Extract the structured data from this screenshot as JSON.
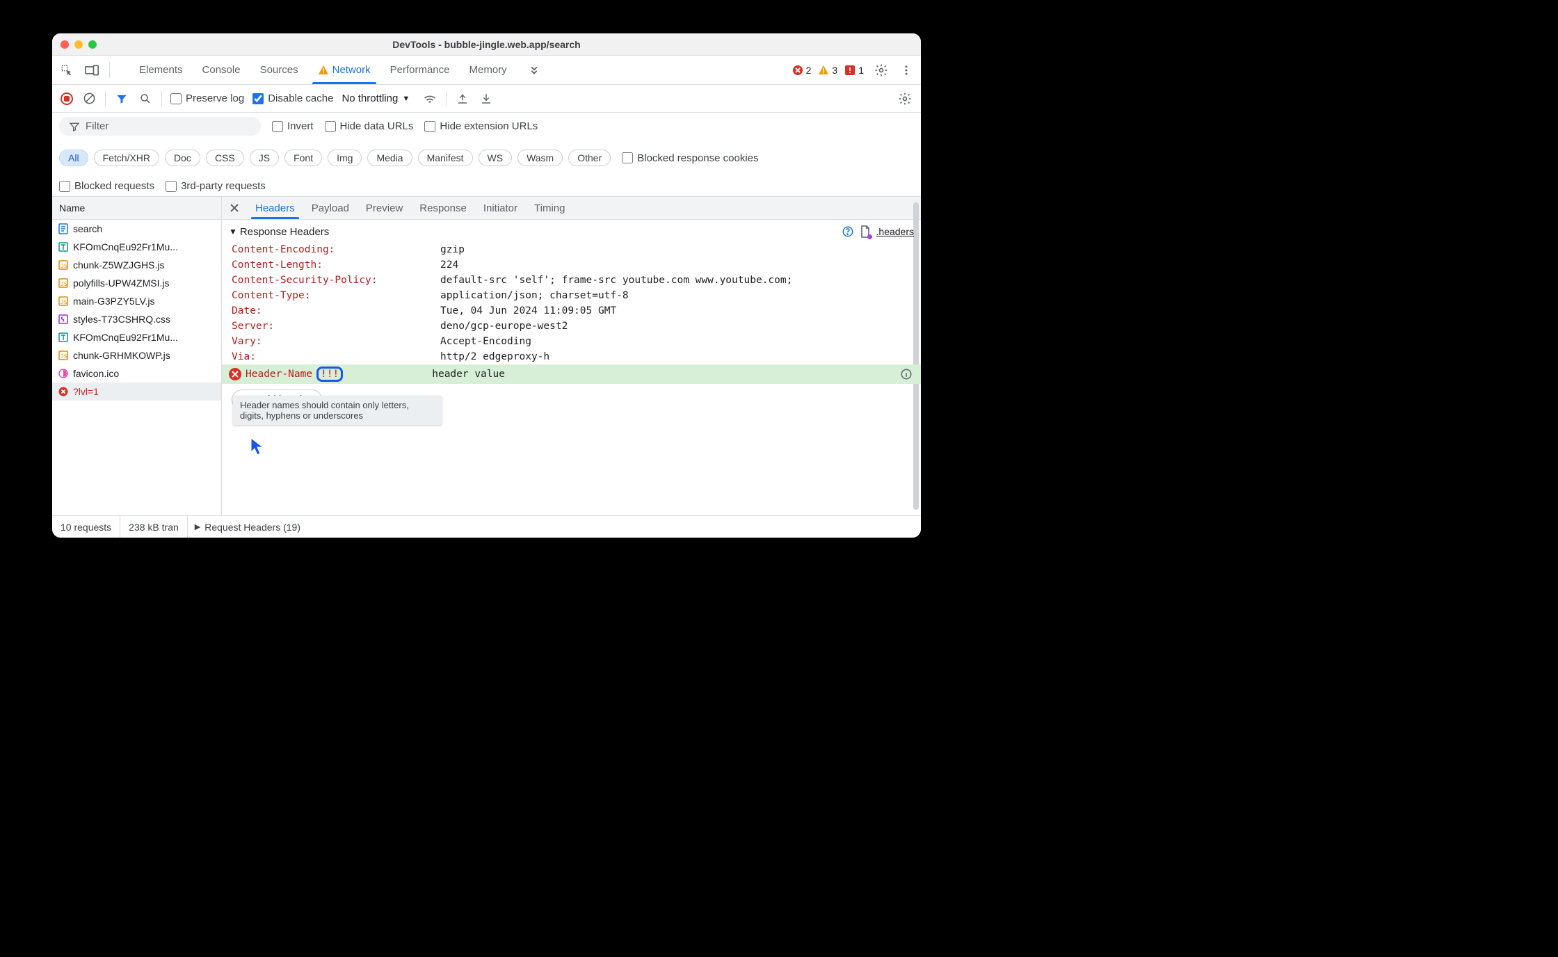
{
  "window": {
    "title": "DevTools - bubble-jingle.web.app/search"
  },
  "devtools_tabs": {
    "items": [
      "Elements",
      "Console",
      "Sources",
      "Network",
      "Performance",
      "Memory"
    ],
    "active": "Network"
  },
  "indicators": {
    "errors": "2",
    "warnings": "3",
    "issues": "1"
  },
  "net_toolbar": {
    "preserve_log": "Preserve log",
    "disable_cache": "Disable cache",
    "throttling": "No throttling"
  },
  "filterbar": {
    "filter_placeholder": "Filter",
    "invert": "Invert",
    "hide_data_urls": "Hide data URLs",
    "hide_ext_urls": "Hide extension URLs",
    "type_chips": [
      "All",
      "Fetch/XHR",
      "Doc",
      "CSS",
      "JS",
      "Font",
      "Img",
      "Media",
      "Manifest",
      "WS",
      "Wasm",
      "Other"
    ],
    "blocked_cookies": "Blocked response cookies",
    "blocked_requests": "Blocked requests",
    "third_party": "3rd-party requests"
  },
  "name_col_header": "Name",
  "requests": [
    {
      "icon": "doc-blue",
      "name": "search"
    },
    {
      "icon": "font",
      "name": "KFOmCnqEu92Fr1Mu..."
    },
    {
      "icon": "js",
      "name": "chunk-Z5WZJGHS.js"
    },
    {
      "icon": "js",
      "name": "polyfills-UPW4ZMSI.js"
    },
    {
      "icon": "js",
      "name": "main-G3PZY5LV.js"
    },
    {
      "icon": "css",
      "name": "styles-T73CSHRQ.css"
    },
    {
      "icon": "font",
      "name": "KFOmCnqEu92Fr1Mu..."
    },
    {
      "icon": "js",
      "name": "chunk-GRHMKOWP.js"
    },
    {
      "icon": "fav",
      "name": "favicon.ico"
    },
    {
      "icon": "err",
      "name": "?lvl=1",
      "selected": true,
      "error": true
    }
  ],
  "detail_tabs": {
    "items": [
      "Headers",
      "Payload",
      "Preview",
      "Response",
      "Initiator",
      "Timing"
    ],
    "active": "Headers"
  },
  "response_headers": {
    "title": "Response Headers",
    "overrides_link": ".headers",
    "rows": [
      {
        "name": "Content-Encoding:",
        "value": "gzip"
      },
      {
        "name": "Content-Length:",
        "value": "224"
      },
      {
        "name": "Content-Security-Policy:",
        "value": "default-src 'self'; frame-src youtube.com www.youtube.com;"
      },
      {
        "name": "Content-Type:",
        "value": "application/json; charset=utf-8"
      },
      {
        "name": "Date:",
        "value": "Tue, 04 Jun 2024 11:09:05 GMT"
      },
      {
        "name": "Server:",
        "value": "deno/gcp-europe-west2"
      },
      {
        "name": "Vary:",
        "value": "Accept-Encoding"
      },
      {
        "name": "Via:",
        "value": "http/2 edgeproxy-h"
      }
    ],
    "new_header": {
      "name": "Header-Name",
      "invalid_suffix": "!!!",
      "value": "header value"
    },
    "tooltip": "Header names should contain only letters, digits, hyphens or underscores",
    "add_header": "Add header"
  },
  "request_headers": {
    "title": "Request Headers (19)"
  },
  "statusbar": {
    "requests": "10 requests",
    "transferred": "238 kB tran"
  }
}
